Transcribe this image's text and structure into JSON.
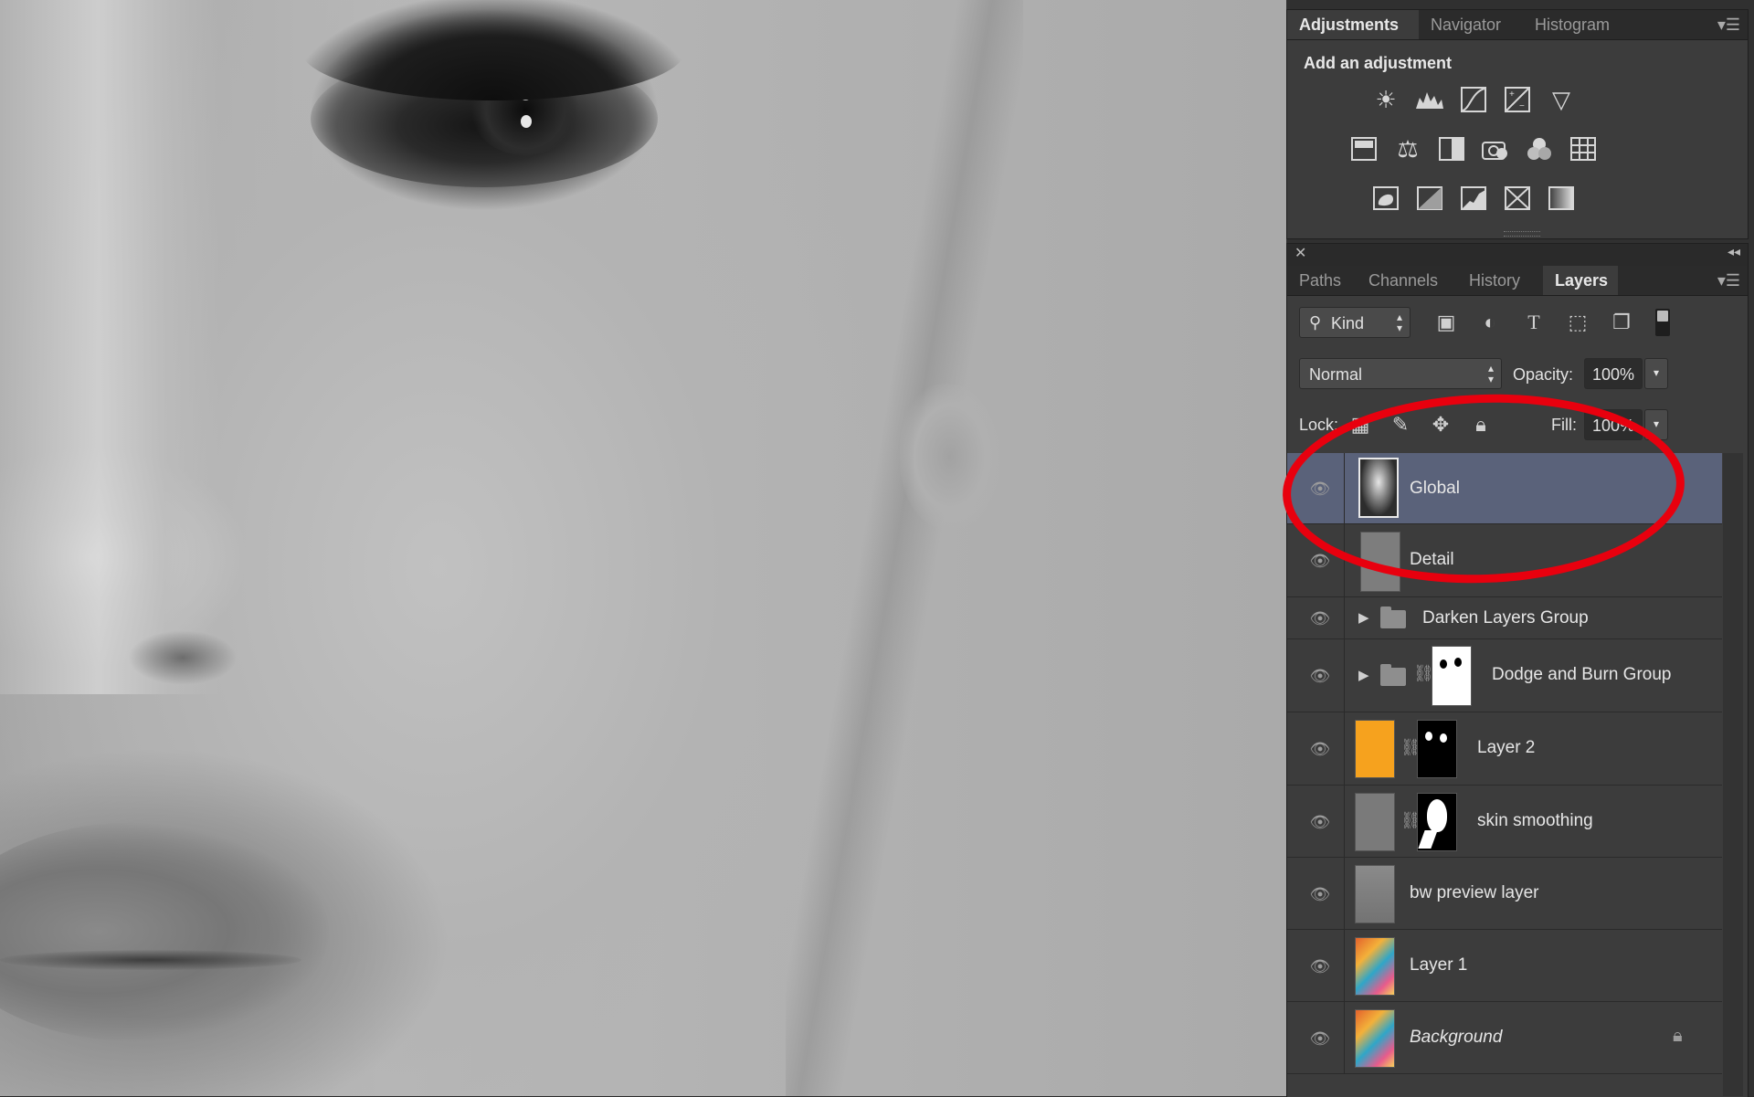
{
  "adjustments_panel": {
    "tabs": [
      {
        "label": "Adjustments",
        "active": true
      },
      {
        "label": "Navigator",
        "active": false
      },
      {
        "label": "Histogram",
        "active": false
      }
    ],
    "heading": "Add an adjustment",
    "icons_row1": [
      "brightness-contrast-icon",
      "levels-icon",
      "curves-icon",
      "exposure-icon",
      "vibrance-icon"
    ],
    "icons_row2": [
      "hue-saturation-icon",
      "color-balance-icon",
      "black-white-icon",
      "photo-filter-icon",
      "channel-mixer-icon",
      "color-lookup-icon"
    ],
    "icons_row3": [
      "invert-icon",
      "posterize-icon",
      "threshold-icon",
      "selective-color-icon",
      "gradient-map-icon"
    ]
  },
  "layers_panel": {
    "tabs": [
      {
        "label": "Paths",
        "active": false
      },
      {
        "label": "Channels",
        "active": false
      },
      {
        "label": "History",
        "active": false
      },
      {
        "label": "Layers",
        "active": true
      }
    ],
    "filter_kind": "Kind",
    "blend_mode": "Normal",
    "opacity_label": "Opacity:",
    "opacity_value": "100%",
    "lock_label": "Lock:",
    "fill_label": "Fill:",
    "fill_value": "100%",
    "layers": [
      {
        "name": "Global",
        "selected": true,
        "visible": true,
        "type": "pixel"
      },
      {
        "name": "Detail",
        "selected": false,
        "visible": true,
        "type": "pixel"
      },
      {
        "name": "Darken Layers Group",
        "selected": false,
        "visible": true,
        "type": "group"
      },
      {
        "name": "Dodge and Burn Group",
        "selected": false,
        "visible": true,
        "type": "group-masked"
      },
      {
        "name": "Layer 2",
        "selected": false,
        "visible": true,
        "type": "fill-masked"
      },
      {
        "name": "skin smoothing",
        "selected": false,
        "visible": true,
        "type": "pixel-masked"
      },
      {
        "name": "bw preview layer",
        "selected": false,
        "visible": true,
        "type": "pixel"
      },
      {
        "name": "Layer 1",
        "selected": false,
        "visible": true,
        "type": "pixel"
      },
      {
        "name": "Background",
        "selected": false,
        "visible": true,
        "type": "background",
        "locked": true
      }
    ]
  },
  "colors": {
    "selection": "#5a627a",
    "annotation_red": "#e8000e",
    "layer2_fill": "#f6a21e"
  }
}
